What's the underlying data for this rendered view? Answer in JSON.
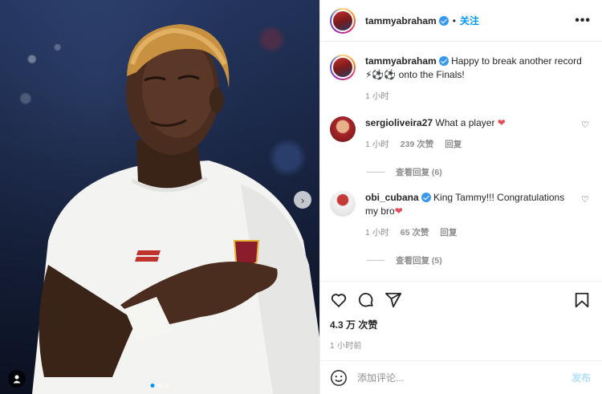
{
  "header": {
    "username": "tammyabraham",
    "separator": "•",
    "follow_label": "关注",
    "more_label": "•••"
  },
  "caption": {
    "username": "tammyabraham",
    "text_line1": "Happy to break another record",
    "text_line2": "⚡⚽⚽ onto the Finals!",
    "time": "1 小时"
  },
  "comments": [
    {
      "username": "sergioliveira27",
      "text": "What a player",
      "emoji": "❤",
      "time": "1 小时",
      "likes": "239 次赞",
      "reply_label": "回复",
      "view_replies": "查看回复 (6)"
    },
    {
      "username": "obi_cubana",
      "text_line1": "King Tammy!!! Congratulations",
      "text_line2": "my bro",
      "emoji": "❤",
      "time": "1 小时",
      "likes": "65 次赞",
      "reply_label": "回复",
      "view_replies": "查看回复 (5)"
    }
  ],
  "actions": {
    "likes": "4.3 万 次赞",
    "time": "1 小时前"
  },
  "add_comment": {
    "placeholder": "添加评论...",
    "post_label": "发布"
  },
  "media": {
    "next_label": "›",
    "slide_count": 3,
    "current_slide": 1
  },
  "colors": {
    "accent": "#0095f6",
    "verified": "#3897f0",
    "heart": "#ed4956",
    "muted": "#8e8e8e"
  }
}
